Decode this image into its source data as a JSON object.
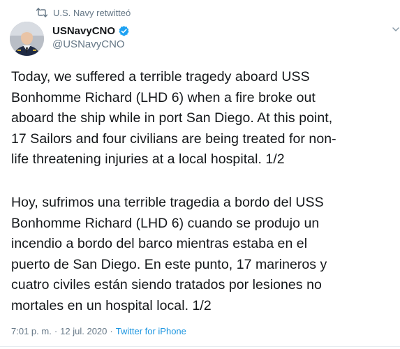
{
  "retweet": {
    "label": "U.S. Navy retwitteó",
    "icon": "retweet-icon"
  },
  "author": {
    "display_name": "USNavyCNO",
    "handle": "@USNavyCNO",
    "verified": true,
    "verified_icon": "verified-badge-icon"
  },
  "tweet": {
    "text_en": "Today, we suffered a terrible tragedy aboard USS\nBonhomme Richard (LHD 6) when a fire broke out\naboard the ship while in port San Diego. At this point,\n17 Sailors and four civilians are being treated for non-\nlife threatening injuries at a local hospital. 1/2",
    "text_es": "Hoy, sufrimos una terrible tragedia a bordo del USS\nBonhomme Richard (LHD 6) cuando se produjo un\nincendio a bordo del barco mientras estaba en el\npuerto de San Diego. En este punto, 17 marineros y\ncuatro civiles están siendo tratados por lesiones no\nmortales en un hospital local. 1/2"
  },
  "meta": {
    "time": "7:01 p. m.",
    "separator": "·",
    "date": "12 jul. 2020",
    "source": "Twitter for iPhone"
  },
  "colors": {
    "text": "#14171a",
    "secondary": "#657786",
    "link": "#1b95e0",
    "verified": "#1da1f2"
  }
}
